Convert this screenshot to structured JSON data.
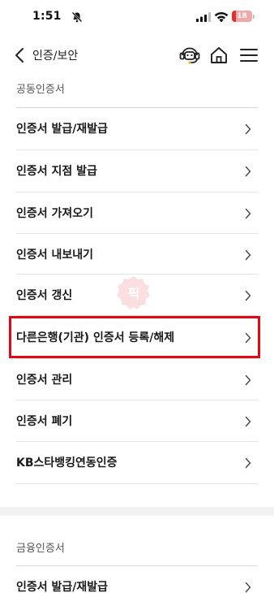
{
  "status_bar": {
    "time": "1:51",
    "battery_level": 18,
    "battery_text": "18",
    "battery_color": "#e03131"
  },
  "header": {
    "title": "인증/보안",
    "icons": [
      "chatbot-icon",
      "home-icon",
      "menu-icon"
    ]
  },
  "sections": [
    {
      "label": "공동인증서",
      "items": [
        "인증서 발급/재발급",
        "인증서 지점 발급",
        "인증서 가져오기",
        "인증서 내보내기",
        "인증서 갱신",
        "다른은행(기관) 인증서 등록/해제",
        "인증서 관리",
        "인증서 폐기",
        "KB스타뱅킹연동인증"
      ],
      "highlighted_item": "다른은행(기관) 인증서 등록/해제"
    },
    {
      "label": "금융인증서",
      "items": [
        "인증서 발급/재발급"
      ]
    }
  ],
  "watermark": {
    "text": "픽"
  },
  "colors": {
    "highlight": "#e30613",
    "band": "#f2f2f2"
  }
}
